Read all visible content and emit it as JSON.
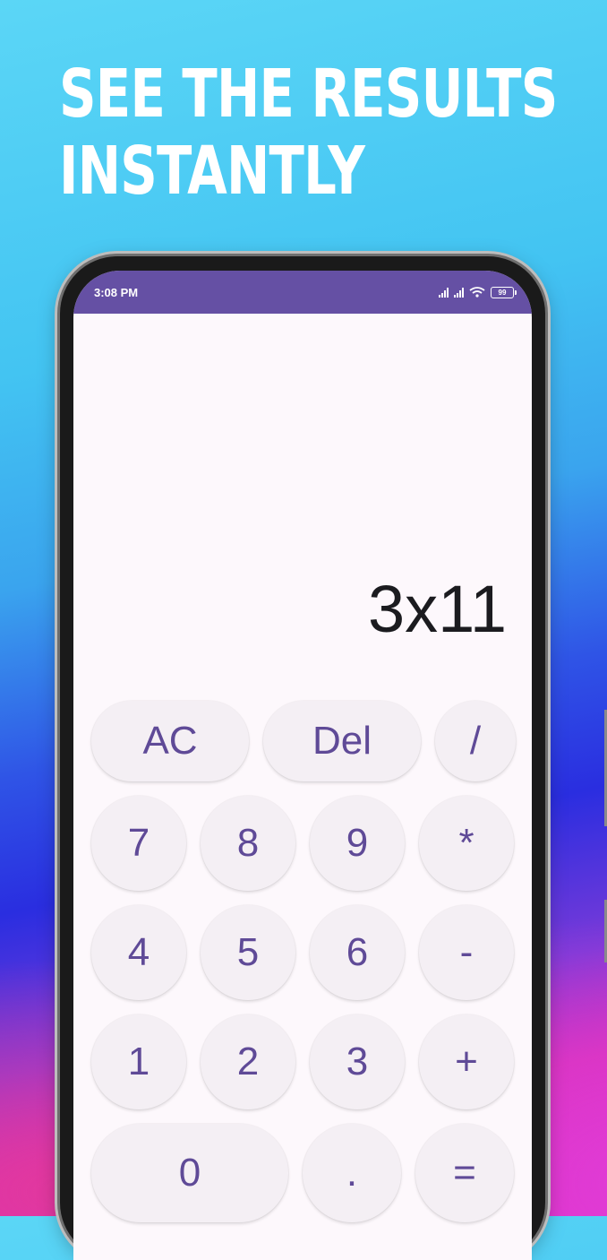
{
  "promo": {
    "line1": "SEE THE RESULTS",
    "line2": "INSTANTLY"
  },
  "status_bar": {
    "time": "3:08 PM",
    "battery": "99"
  },
  "calculator": {
    "display": "3x11",
    "keys": {
      "ac": "AC",
      "del": "Del",
      "divide": "/",
      "seven": "7",
      "eight": "8",
      "nine": "9",
      "multiply": "*",
      "four": "4",
      "five": "5",
      "six": "6",
      "minus": "-",
      "one": "1",
      "two": "2",
      "three": "3",
      "plus": "+",
      "zero": "0",
      "dot": ".",
      "equals": "="
    }
  },
  "colors": {
    "accent": "#6550a4",
    "key_text": "#5f4a97",
    "key_bg": "#f4eff4",
    "screen_bg": "#fdf8fc"
  }
}
